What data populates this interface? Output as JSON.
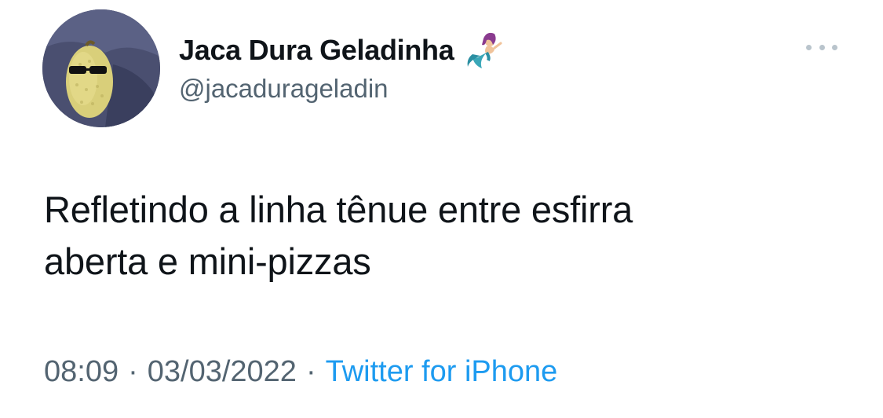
{
  "author": {
    "display_name": "Jaca Dura Geladinha",
    "handle": "@jacadurageladin",
    "avatar_icon": "jackfruit-with-sunglasses",
    "name_emoji_icon": "mermaid-emoji"
  },
  "tweet": {
    "text_line1": "Refletindo a linha tênue entre esfirra",
    "text_line2": "aberta e mini-pizzas"
  },
  "meta": {
    "time": "08:09",
    "separator": "·",
    "date": "03/03/2022",
    "source": "Twitter for iPhone"
  },
  "colors": {
    "text_primary": "#0f1419",
    "text_secondary": "#536471",
    "link": "#1d9bf0"
  }
}
